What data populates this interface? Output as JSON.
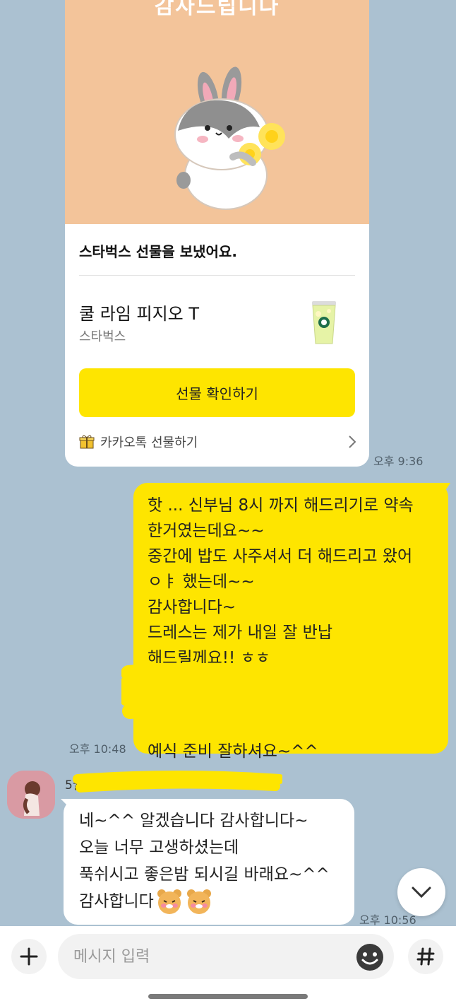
{
  "gift": {
    "banner_text": "감사드립니다",
    "title": "스타벅스 선물을 보냈어요.",
    "product_name": "쿨 라임 피지오 T",
    "product_brand": "스타벅스",
    "confirm_button": "선물 확인하기",
    "footer_label": "카카오톡 선물하기",
    "time": "오후 9:36"
  },
  "sent_message": {
    "lines": [
      "핫 ... 신부님 8시 까지 해드리기로 약속",
      "한거였는데요~~",
      "중간에 밥도 사주셔서 더 해드리고 왔어",
      "ㅇㅑ 했는데~~",
      "감사합니다~",
      "드레스는 제가 내일 잘 반납",
      "해드릴께요!! ㅎㅎ",
      "예식 준비 잘하셔요~^^"
    ],
    "time": "오후 10:48"
  },
  "received_message": {
    "sender_name": "5월",
    "lines": [
      "네~^^ 알겠습니다 감사합니다~",
      "오늘 너무 고생하셨는데",
      "푹쉬시고 좋은밤 되시길 바래요~^^",
      "감사합니다"
    ],
    "time": "오후 10:56"
  },
  "input": {
    "placeholder": "메시지 입력"
  },
  "colors": {
    "chat_background": "#abc1d1",
    "sent_bubble": "#fee500",
    "received_bubble": "#ffffff",
    "gift_button": "#fee500",
    "gift_image_background": "#f3c49a"
  },
  "icons": {
    "plus": "plus-icon",
    "emoji": "smiley-icon",
    "hash": "hash-icon",
    "scroll": "chevron-down-icon",
    "footer": "gift-box-icon",
    "footer_arrow": "chevron-right-icon"
  }
}
